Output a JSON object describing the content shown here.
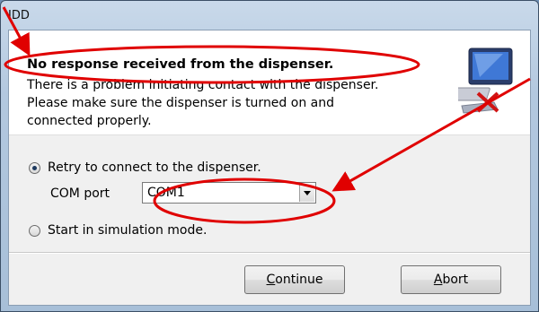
{
  "window": {
    "title": "IDD"
  },
  "header": {
    "title": "No response received from the dispenser.",
    "message_lines": [
      "There is a problem initiating contact with the dispenser.",
      "Please make sure the dispenser is turned on and",
      "connected properly."
    ],
    "icon": "computer-disconnected-icon"
  },
  "options": {
    "retry_label": "Retry to connect to the dispenser.",
    "retry_checked": true,
    "com_port_label": "COM port",
    "com_port_value": "COM1",
    "simulation_label": "Start in simulation mode.",
    "simulation_checked": false
  },
  "buttons": {
    "continue_mnemonic": "C",
    "continue_rest": "ontinue",
    "abort_mnemonic": "A",
    "abort_rest": "bort"
  },
  "annotations": {
    "color": "#e00000"
  }
}
